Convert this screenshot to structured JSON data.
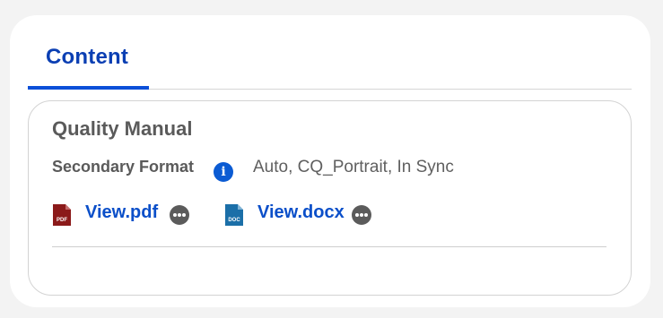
{
  "tabs": [
    {
      "label": "Content",
      "active": true
    }
  ],
  "card": {
    "title": "Quality Manual",
    "secondary_format_label": "Secondary Format",
    "secondary_format_value": "Auto, CQ_Portrait, In Sync",
    "files": [
      {
        "icon_text": "PDF",
        "link": "View.pdf",
        "icon_color": "#8b1a1a"
      },
      {
        "icon_text": "DOC",
        "link": "View.docx",
        "icon_color": "#1b6fa8"
      }
    ]
  },
  "colors": {
    "accent": "#0b4fd8",
    "link": "#0b4fc9",
    "text_muted": "#5a5a5a"
  },
  "icons": {
    "info": "info-icon",
    "more": "more-options-icon"
  }
}
